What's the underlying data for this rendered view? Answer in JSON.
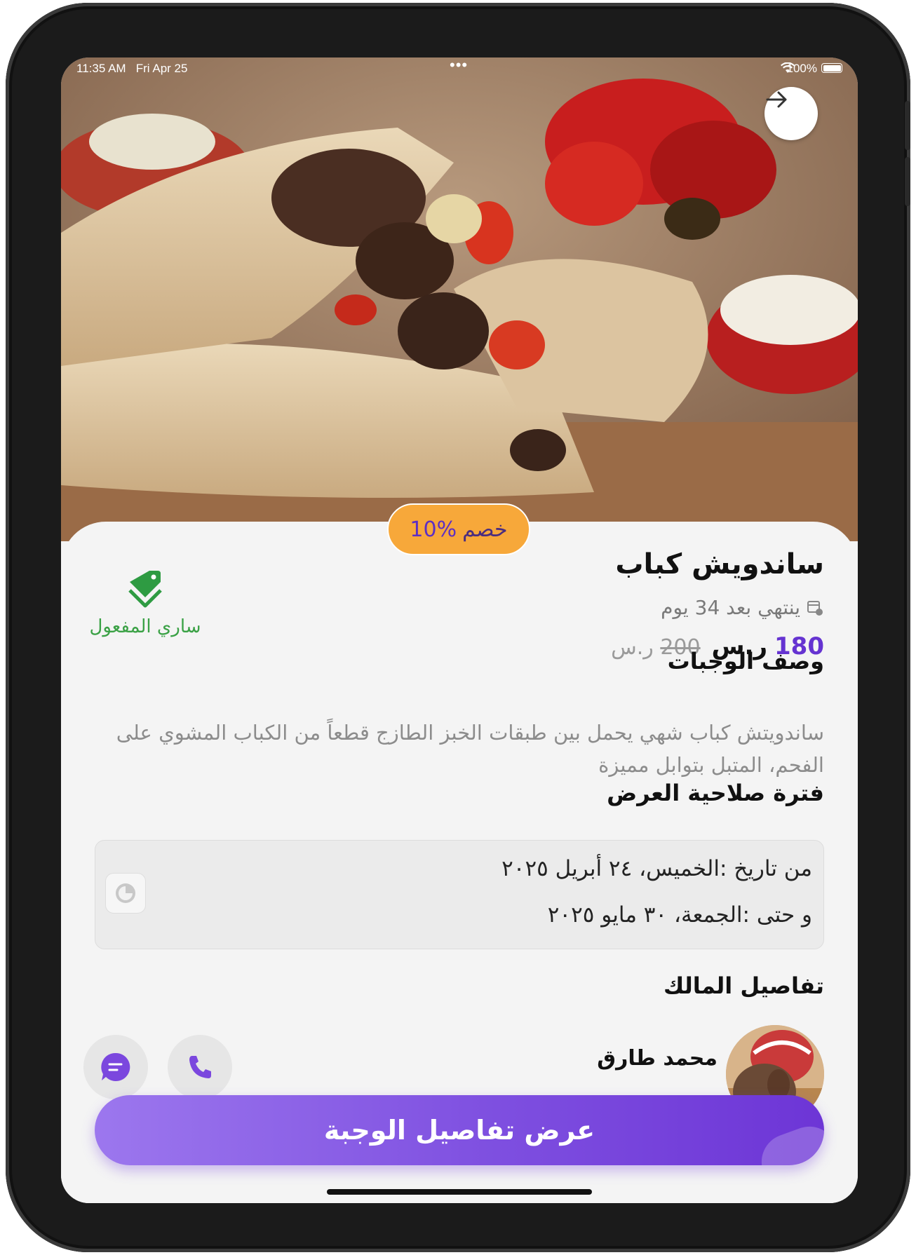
{
  "status_bar": {
    "time": "11:35 AM",
    "date": "Fri Apr 25",
    "battery": "100%"
  },
  "discount": {
    "label": "خصم",
    "value": "10%"
  },
  "meal": {
    "title": "ساندويش كباب",
    "ends_in": "ينتهي بعد 34 يوم",
    "price_new": "180",
    "price_new_currency": "ر.س",
    "price_old": "200",
    "price_old_currency": "ر.س"
  },
  "seller": {
    "name": "ساري المفعول",
    "icon": "tag-icon",
    "color": "#3aa145"
  },
  "description": {
    "title": "وصف الوجبات",
    "text": "ساندويتش كباب شهي يحمل بين طبقات الخبز الطازج قطعاً من الكباب المشوي على الفحم، المتبل بتوابل مميزة"
  },
  "validity": {
    "title": "فترة صلاحية العرض",
    "from": "من تاريخ :الخميس، ٢٤ أبريل ٢٠٢٥",
    "to": "و حتى :الجمعة، ٣٠ مايو ٢٠٢٥"
  },
  "owner": {
    "section_title": "تفاصيل المالك",
    "name": "محمد طارق"
  },
  "cta": {
    "label": "عرض تفاصيل الوجبة"
  },
  "colors": {
    "accent": "#6d35d6",
    "discount_bg": "#f7a83a",
    "price": "#6533d1"
  }
}
